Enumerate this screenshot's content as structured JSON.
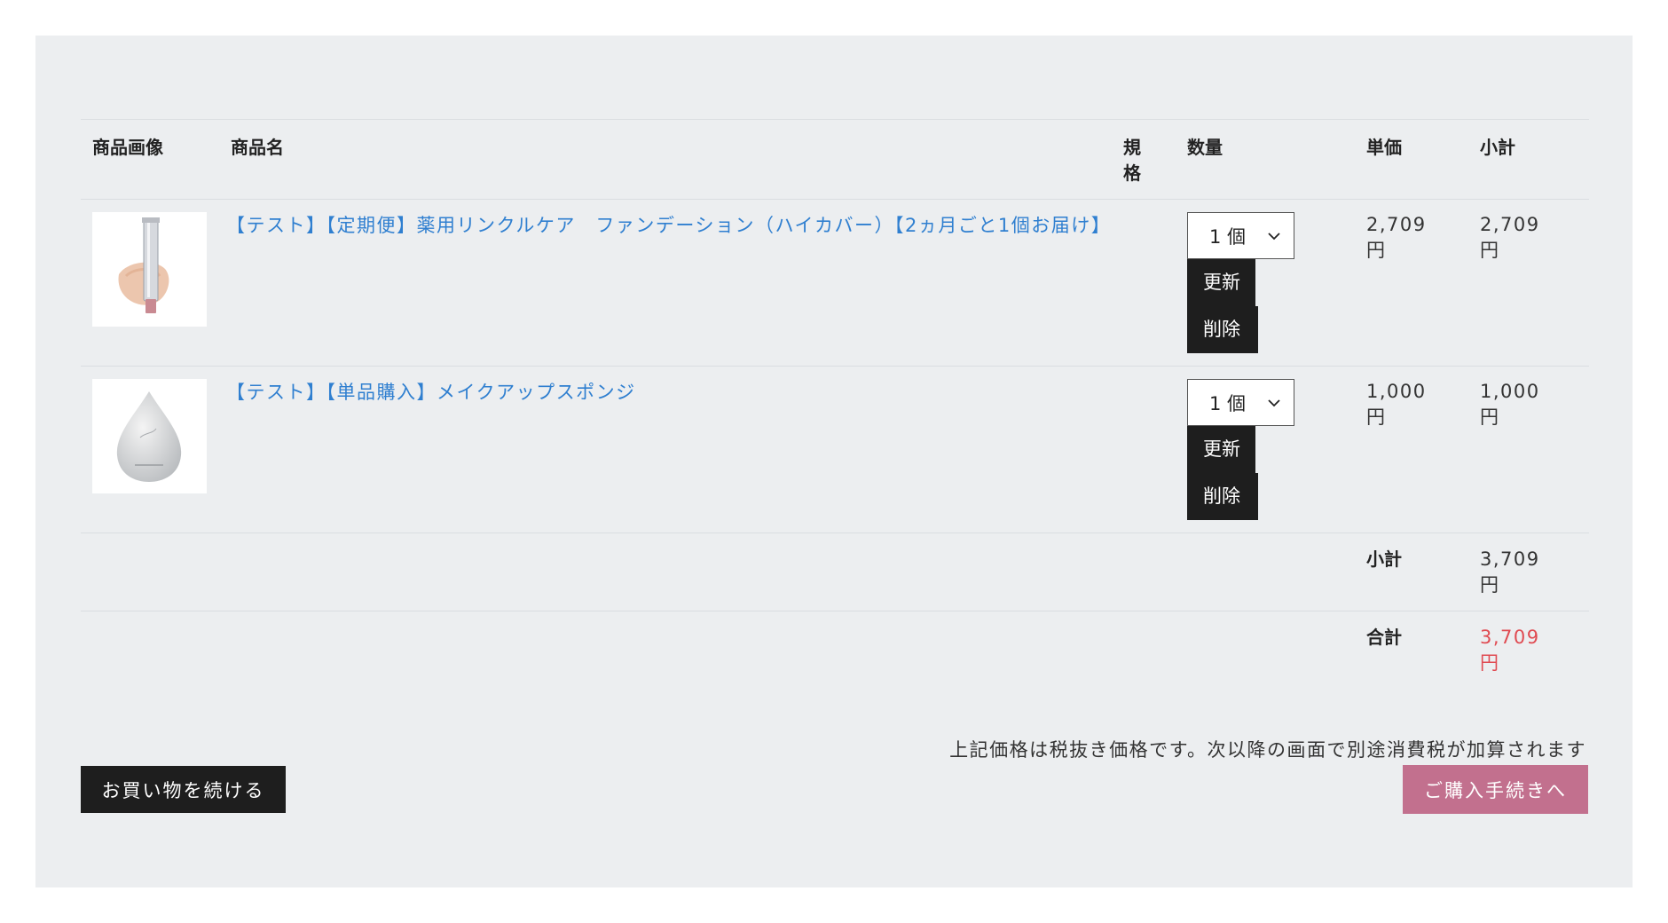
{
  "columns": {
    "image": "商品画像",
    "name": "商品名",
    "spec_line1": "規",
    "spec_line2": "格",
    "quantity": "数量",
    "unit_price": "単価",
    "subtotal": "小計"
  },
  "items": [
    {
      "name": "【テスト】【定期便】薬用リンクルケア　ファンデーション（ハイカバー）【2ヵ月ごと1個お届け】",
      "image_icon": "foundation-tube-icon",
      "quantity": "1 個",
      "update_label": "更新",
      "delete_label": "削除",
      "unit_price": "2,709",
      "subtotal": "2,709",
      "currency": "円"
    },
    {
      "name": "【テスト】【単品購入】メイクアップスポンジ",
      "image_icon": "makeup-sponge-icon",
      "quantity": "1 個",
      "update_label": "更新",
      "delete_label": "削除",
      "unit_price": "1,000",
      "subtotal": "1,000",
      "currency": "円"
    }
  ],
  "summary": {
    "subtotal_label": "小計",
    "subtotal_value": "3,709",
    "total_label": "合計",
    "total_value": "3,709",
    "currency": "円"
  },
  "footer": {
    "tax_note": "上記価格は税抜き価格です。次以降の画面で別途消費税が加算されます",
    "continue_label": "お買い物を続ける",
    "checkout_label": "ご購入手続きへ"
  },
  "colors": {
    "panel_bg": "#eceef0",
    "link": "#2f7fd0",
    "total_price": "#e04b52",
    "dark_button": "#1e1e1e",
    "checkout_button": "#c2708e"
  }
}
